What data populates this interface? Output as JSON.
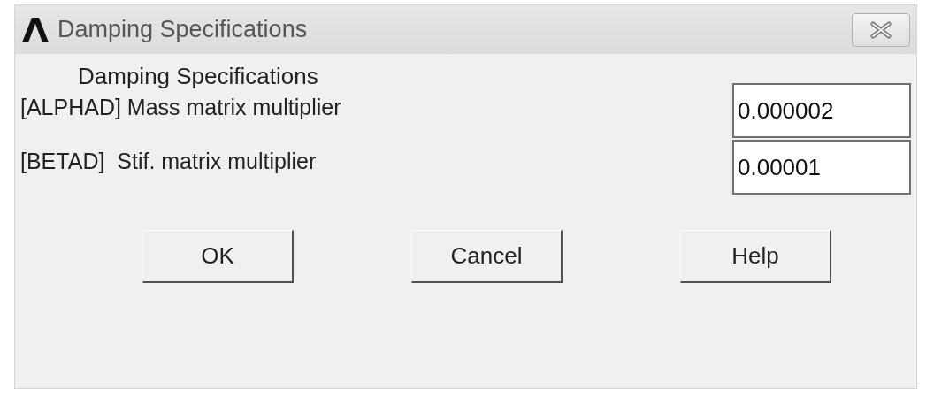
{
  "window": {
    "title": "Damping Specifications"
  },
  "heading": "Damping Specifications",
  "fields": [
    {
      "label": "[ALPHAD] Mass matrix multiplier",
      "value": "0.000002"
    },
    {
      "label": "[BETAD]  Stif. matrix multiplier",
      "value": "0.00001"
    }
  ],
  "buttons": [
    "OK",
    "Cancel",
    "Help"
  ]
}
